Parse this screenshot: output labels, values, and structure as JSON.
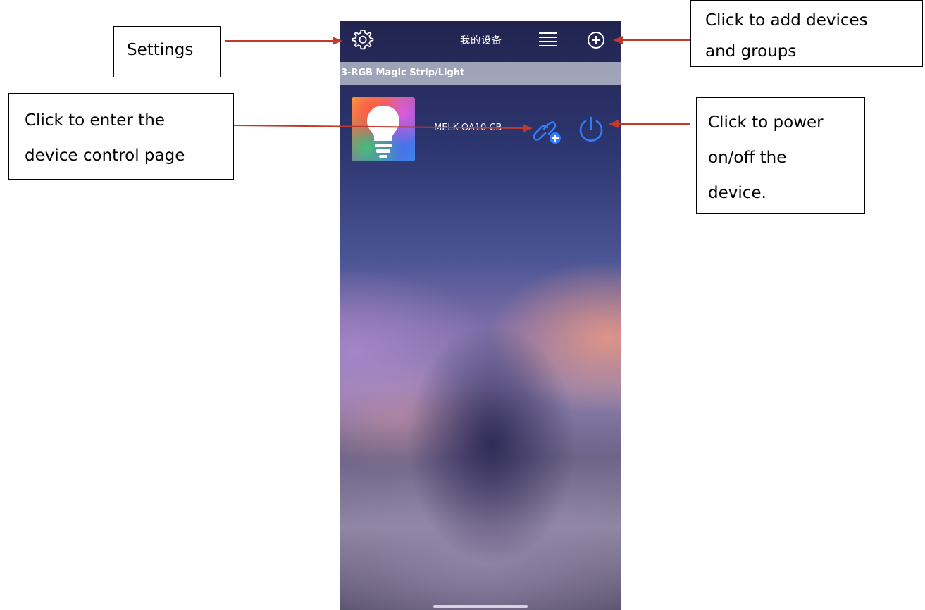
{
  "header": {
    "title": "我的设备"
  },
  "icons": {
    "settings": "gear-icon",
    "list": "list-icon",
    "add": "plus-circle-icon",
    "link": "link-add-icon",
    "power": "power-icon"
  },
  "section": {
    "title": "3-RGB Magic Strip/Light"
  },
  "device": {
    "name": "MELK-OA10 CB"
  },
  "annotations": {
    "settings": "Settings",
    "enter_line1": "Click to enter the",
    "enter_line2": "device control page",
    "add_line1": "Click to add devices",
    "add_line2": "and groups",
    "power_line1": "Click to power",
    "power_line2": "on/off the",
    "power_line3": "device."
  },
  "colors": {
    "accent_blue": "#2f7dff",
    "arrow_red": "#c0392b"
  }
}
